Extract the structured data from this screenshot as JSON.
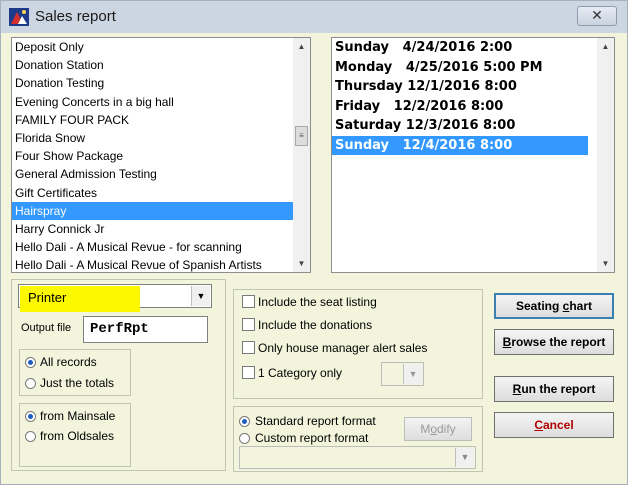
{
  "window": {
    "title": "Sales report",
    "close_glyph": "✕"
  },
  "events": {
    "items": [
      "Deposit Only",
      "Donation Station",
      "Donation Testing",
      "Evening Concerts in a big hall",
      "FAMILY FOUR PACK",
      "Florida Snow",
      "Four Show Package",
      "General Admission Testing",
      "Gift Certificates",
      "Hairspray",
      "Harry Connick Jr",
      "Hello Dali - A Musical Revue - for scanning",
      "Hello Dali - A Musical Revue of Spanish Artists"
    ],
    "selected_index": 9
  },
  "performances": {
    "items": [
      "Sunday   4/24/2016 2:00",
      "Monday   4/25/2016 5:00 PM",
      "Thursday 12/1/2016 8:00",
      "Friday   12/2/2016 8:00",
      "Saturday 12/3/2016 8:00",
      "Sunday   12/4/2016 8:00"
    ],
    "selected_index": 5
  },
  "output": {
    "destination": "Printer",
    "file_label": "Output file",
    "file_value": "PerfRpt"
  },
  "records": {
    "all": "All records",
    "totals": "Just the totals",
    "selected": "all"
  },
  "source": {
    "mainsale": "from Mainsale",
    "oldsales": "from Oldsales",
    "selected": "mainsale"
  },
  "options": {
    "seat_listing": "Include the seat listing",
    "donations": "Include the donations",
    "alert_sales": "Only house manager alert sales",
    "category_only": "1 Category only",
    "category_value": ""
  },
  "format": {
    "standard": "Standard report format",
    "custom": "Custom report format",
    "modify_pre": "M",
    "modify_ul": "o",
    "modify_post": "dify",
    "selected": "standard",
    "custom_value": ""
  },
  "buttons": {
    "seating_pre": "Seating ",
    "seating_ul": "c",
    "seating_post": "hart",
    "browse_pre": "",
    "browse_ul": "B",
    "browse_post": "rowse the report",
    "run_pre": "",
    "run_ul": "R",
    "run_post": "un the report",
    "cancel_pre": "",
    "cancel_ul": "C",
    "cancel_post": "ancel"
  },
  "icons": {
    "scroll_up": "▲",
    "scroll_down": "▼",
    "dropdown": "▼",
    "thumb_grip": "≡"
  }
}
